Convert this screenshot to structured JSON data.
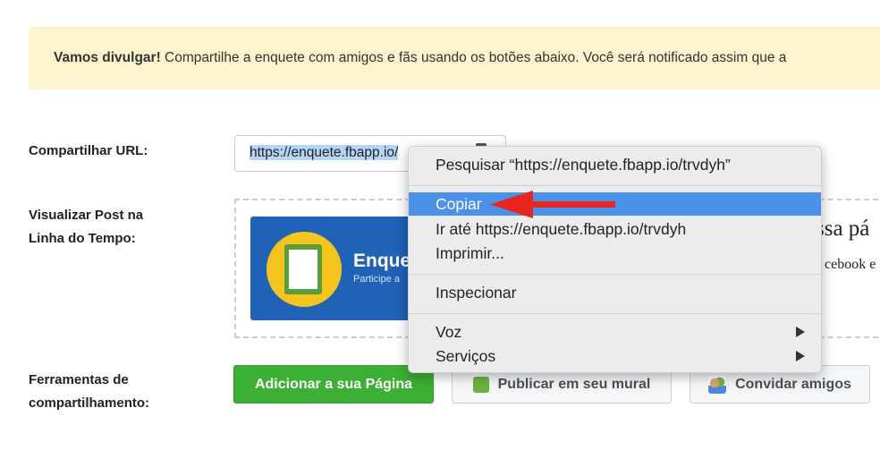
{
  "banner": {
    "bold": "Vamos divulgar!",
    "text": " Compartilhe a enquete com amigos e fãs usando os botões abaixo. Você será notificado assim que a"
  },
  "labels": {
    "share_url": "Compartilhar URL:",
    "preview_1": "Visualizar Post na",
    "preview_2": "Linha do Tempo:",
    "tools_1": "Ferramentas de",
    "tools_2": "compartilhamento:"
  },
  "url_input": {
    "value": "https://enquete.fbapp.io/trvdyh",
    "visible": "https://enquete.fbapp.io/"
  },
  "preview_card": {
    "title": "Enque",
    "subtitle": "Participe a",
    "side_title": "ssa pá",
    "side_text": "cebook e"
  },
  "buttons": {
    "add_page": "Adicionar a sua Página",
    "publish": "Publicar em seu mural",
    "invite": "Convidar amigos"
  },
  "context_menu": {
    "items": [
      {
        "label": "Pesquisar “https://enquete.fbapp.io/trvdyh”"
      },
      {
        "label": "Copiar",
        "highlighted": true
      },
      {
        "label": "Ir até https://enquete.fbapp.io/trvdyh"
      },
      {
        "label": "Imprimir..."
      },
      {
        "label": "Inspecionar"
      },
      {
        "label": "Voz",
        "submenu": true
      },
      {
        "label": "Serviços",
        "submenu": true
      }
    ]
  },
  "colors": {
    "highlight": "#4c91e9",
    "green": "#3cb034",
    "arrow": "#e8261e",
    "banner": "#fcf4cc"
  }
}
